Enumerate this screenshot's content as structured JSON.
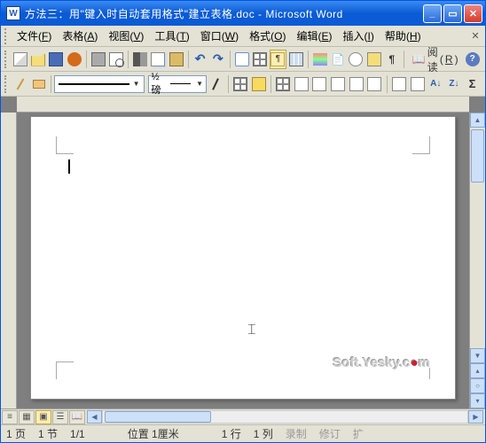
{
  "title": "方法三：用\"键入时自动套用格式\"建立表格.doc - Microsoft Word",
  "menu": {
    "file": {
      "label": "文件",
      "key": "F"
    },
    "table": {
      "label": "表格",
      "key": "A"
    },
    "view": {
      "label": "视图",
      "key": "V"
    },
    "tools": {
      "label": "工具",
      "key": "T"
    },
    "window": {
      "label": "窗口",
      "key": "W"
    },
    "format": {
      "label": "格式",
      "key": "O"
    },
    "edit": {
      "label": "编辑",
      "key": "E"
    },
    "insert": {
      "label": "插入",
      "key": "I"
    },
    "help": {
      "label": "帮助",
      "key": "H"
    }
  },
  "toolbar1": {
    "read_label": "阅读",
    "read_key": "R"
  },
  "toolbar2": {
    "line_weight": "½ 磅"
  },
  "watermark": {
    "text": "Soft.Yesky.c",
    "suffix": "m"
  },
  "status": {
    "page": "1 页",
    "section": "1 节",
    "pages": "1/1",
    "position": "位置 1厘米",
    "line": "1 行",
    "col": "1 列",
    "rec": "录制",
    "rev": "修订",
    "ext": "扩"
  }
}
